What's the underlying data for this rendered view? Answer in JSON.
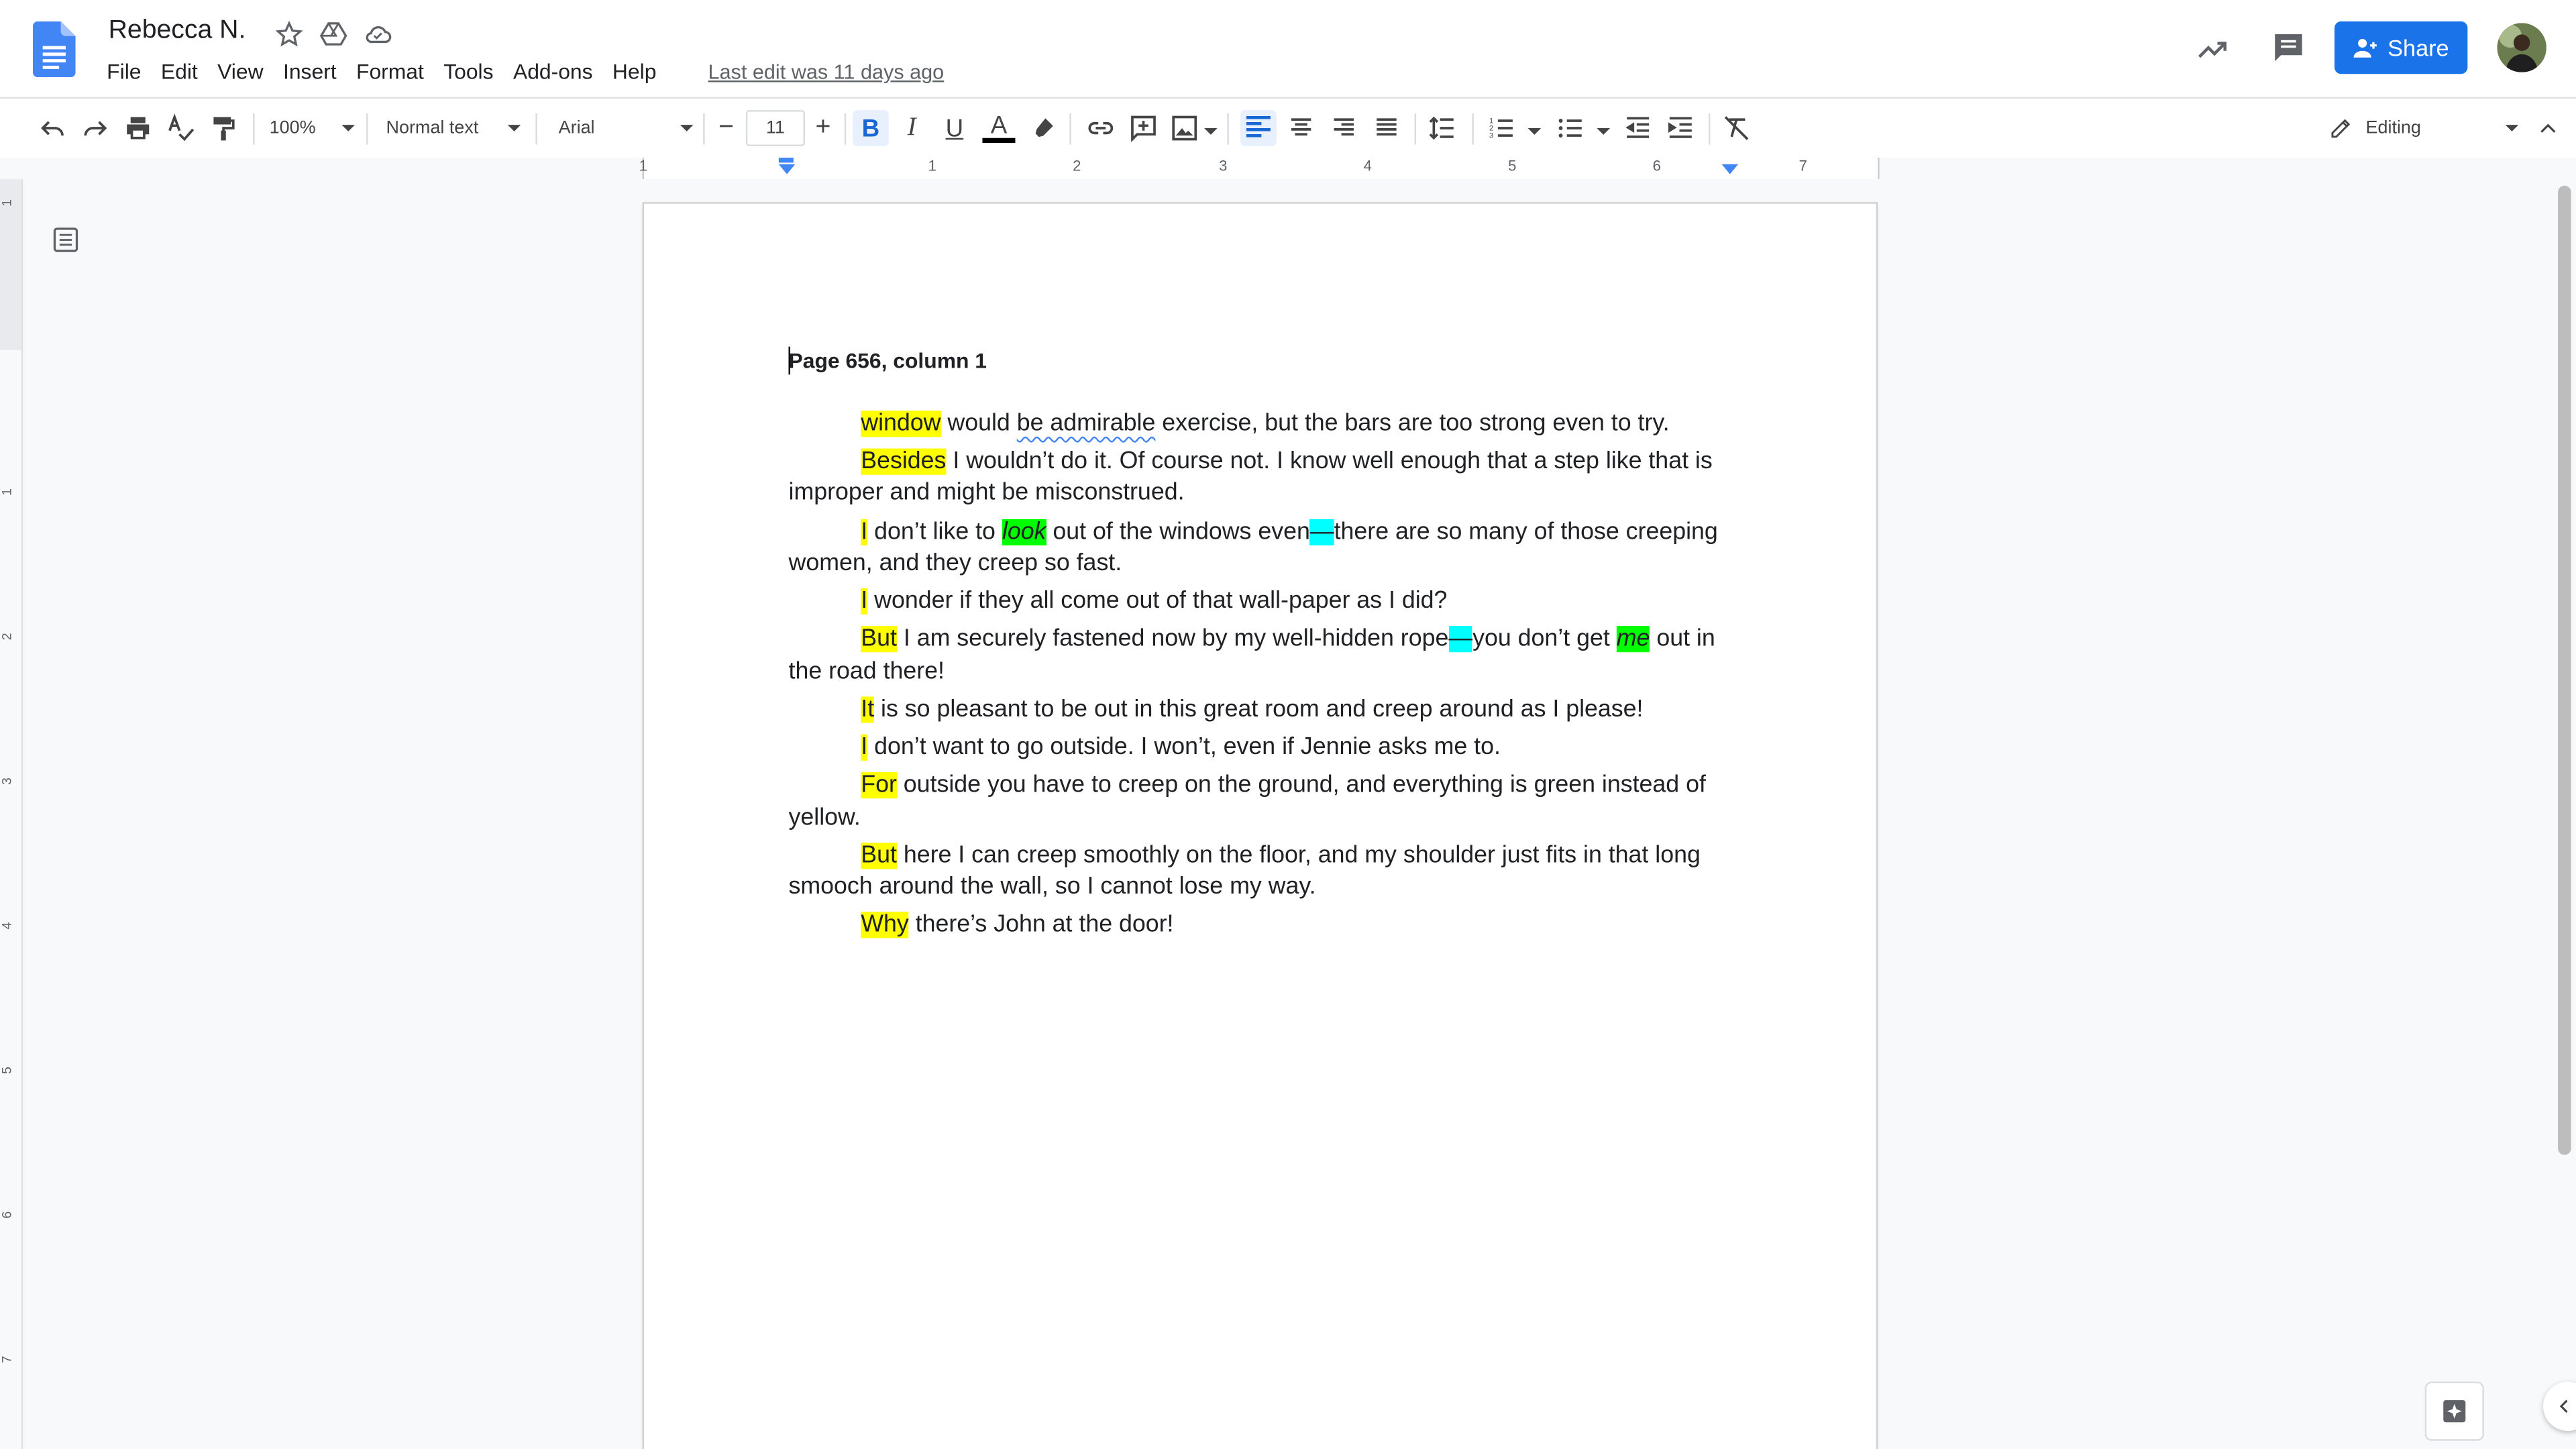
{
  "window": {
    "title": "Rebecca N.",
    "last_edit": "Last edit was 11 days ago"
  },
  "menu": [
    "File",
    "Edit",
    "View",
    "Insert",
    "Format",
    "Tools",
    "Add-ons",
    "Help"
  ],
  "header": {
    "share_label": "Share"
  },
  "toolbar": {
    "zoom": "100%",
    "style": "Normal text",
    "font": "Arial",
    "font_size": "11",
    "mode": "Editing"
  },
  "ruler": {
    "h_numbers": [
      "1",
      "1",
      "2",
      "3",
      "4",
      "5",
      "6",
      "7"
    ],
    "v_numbers": [
      "1",
      "1",
      "2",
      "3",
      "4",
      "5",
      "6",
      "7"
    ]
  },
  "document": {
    "heading": "Page 656, column 1",
    "paragraphs": [
      [
        {
          "t": "window",
          "h": "y"
        },
        {
          "t": " would "
        },
        {
          "t": "be admirable",
          "h": "s"
        },
        {
          "t": " exercise, but the bars are too strong even to try."
        }
      ],
      [
        {
          "t": "Besides",
          "h": "y"
        },
        {
          "t": " I wouldn’t do it. Of course not. I know well enough that a step like that is improper and might be misconstrued."
        }
      ],
      [
        {
          "t": "I",
          "h": "y"
        },
        {
          "t": " don’t like to "
        },
        {
          "t": "look",
          "h": "g"
        },
        {
          "t": " out of the windows even"
        },
        {
          "t": "—",
          "h": "c"
        },
        {
          "t": "there are so many of those creeping women, and they creep so fast."
        }
      ],
      [
        {
          "t": "I",
          "h": "y"
        },
        {
          "t": " wonder if they all come out of that wall-paper as I did?"
        }
      ],
      [
        {
          "t": "But",
          "h": "y"
        },
        {
          "t": " I am securely fastened now by my well-hidden rope"
        },
        {
          "t": "—",
          "h": "c"
        },
        {
          "t": "you don’t get "
        },
        {
          "t": "me",
          "h": "g"
        },
        {
          "t": " out in the road there!"
        }
      ],
      [
        {
          "t": "It",
          "h": "y"
        },
        {
          "t": " is so pleasant to be out in this great room and creep around as I please!"
        }
      ],
      [
        {
          "t": "I",
          "h": "y"
        },
        {
          "t": " don’t want to go outside. I won’t, even if Jennie asks me to."
        }
      ],
      [
        {
          "t": "For",
          "h": "y"
        },
        {
          "t": " outside you have to creep on the ground, and everything is green instead of yellow."
        }
      ],
      [
        {
          "t": "But",
          "h": "y"
        },
        {
          "t": " here I can creep smoothly on the floor, and my shoulder just fits in that long smooch around the wall, so I cannot lose my way."
        }
      ],
      [
        {
          "t": "Why",
          "h": "y"
        },
        {
          "t": " there’s John at the door!"
        }
      ]
    ]
  },
  "colors": {
    "share": "#1a73e8",
    "highlight_yellow": "#ffff00",
    "highlight_green": "#00ff00",
    "highlight_cyan": "#00ffff",
    "docs_blue": "#4285f4"
  },
  "icons": [
    "docs-logo-icon",
    "star-icon",
    "drive-icon",
    "cloud-icon",
    "trending-icon",
    "comment-icon",
    "undo-icon",
    "redo-icon",
    "print-icon",
    "spellcheck-icon",
    "paint-format-icon",
    "bold-icon",
    "italic-icon",
    "underline-icon",
    "text-color-icon",
    "highlight-icon",
    "link-icon",
    "add-comment-icon",
    "image-icon",
    "align-left-icon",
    "align-center-icon",
    "align-right-icon",
    "justify-icon",
    "line-spacing-icon",
    "numbered-list-icon",
    "bulleted-list-icon",
    "decrease-indent-icon",
    "increase-indent-icon",
    "clear-formatting-icon",
    "pencil-icon",
    "collapse-icon",
    "outline-icon",
    "explore-icon"
  ]
}
